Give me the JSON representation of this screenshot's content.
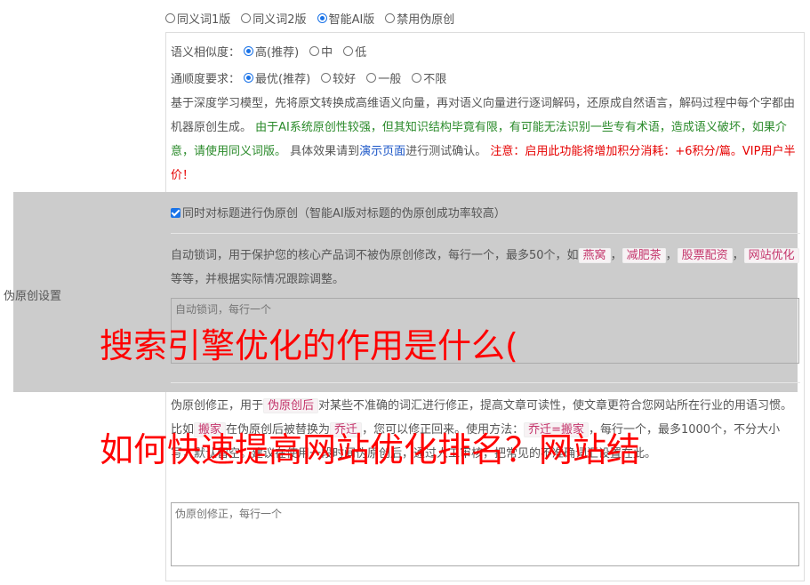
{
  "version_options": {
    "items": [
      "同义词1版",
      "同义词2版",
      "智能AI版",
      "禁用伪原创"
    ],
    "selected": 2
  },
  "similarity": {
    "label": "语义相似度：",
    "items": [
      "高(推荐)",
      "中",
      "低"
    ],
    "selected": 0
  },
  "fluency": {
    "label": "通顺度要求：",
    "items": [
      "最优(推荐)",
      "较好",
      "一般",
      "不限"
    ],
    "selected": 0
  },
  "description": {
    "part1": "基于深度学习模型，先将原文转换成高维语义向量，再对语义向量进行逐词解码，还原成自然语言，解码过程中每个字都由机器原创生成。",
    "part2_green": "由于AI系统原创性较强，但其知识结构毕竟有限，有可能无法识别一些专有术语，造成语义破坏，如果介意，请使用同义词版。",
    "part3": "具体效果请到",
    "link": "演示页面",
    "part4": "进行测试确认。",
    "part5_red": "注意：启用此功能将增加积分消耗：+6积分/篇。VIP用户半价！"
  },
  "section_label": "伪原创设置",
  "title_checkbox": {
    "label": "同时对标题进行伪原创（智能AI版对标题的伪原创成功率较高）",
    "checked": true
  },
  "lock_words": {
    "desc_before": "自动锁词，用于保护您的核心产品词不被伪原创修改，每行一个，最多50个，如",
    "examples": [
      "燕窝",
      "减肥茶",
      "股票配资",
      "网站优化"
    ],
    "desc_after": "等等，并根据实际情况跟踪调整。",
    "placeholder": "自动锁词，每行一个"
  },
  "correction": {
    "desc_before": "伪原创修正，用于",
    "tag": "伪原创后",
    "desc_mid": "对某些不准确的词汇进行修正，提高文章可读性，使文章更符合您网站所在行业的用语习惯。比如",
    "tag2": "搬家",
    "desc_mid2": "在伪原创后被替换为",
    "tag3": "乔迁",
    "desc_mid3": "，您可以修正回来。使用方法：",
    "tag4": "乔迁=搬家",
    "desc_end": "，每行一个，最多1000个，不分大小写，默认留空。建议在使用一段时间伪原创后，通过人工审核，把常见的不准确词汇设置在此。",
    "placeholder": "伪原创修正，每行一个"
  },
  "overlay": {
    "line1": "搜索引擎优化的作用是什么(",
    "line2": "如何快速提高网站优化排名？网站结"
  }
}
